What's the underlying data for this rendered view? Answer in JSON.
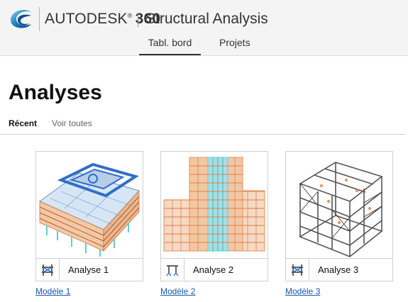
{
  "header": {
    "brand": "AUTODESK",
    "brand_number": "360",
    "brand_mark": "®",
    "product": "Structural Analysis",
    "logo_icon": "autodesk-logo-icon"
  },
  "nav": {
    "tabs": [
      {
        "label": "Tabl. bord",
        "active": true
      },
      {
        "label": "Projets",
        "active": false
      }
    ]
  },
  "main": {
    "title": "Analyses",
    "subtabs": [
      {
        "label": "Récent",
        "active": true
      },
      {
        "label": "Voir toutes",
        "active": false
      }
    ],
    "cards": [
      {
        "label": "Analyse 1",
        "link": "Modèle 1",
        "icon": "frame-structure-icon"
      },
      {
        "label": "Analyse 2",
        "link": "Modèle 2",
        "icon": "frame-supports-icon"
      },
      {
        "label": "Analyse 3",
        "link": "Modèle 3",
        "icon": "frame-structure-icon"
      }
    ]
  },
  "colors": {
    "accent_blue": "#2f6ec9",
    "beam_orange": "#e3905e",
    "column_cyan": "#5fcfd1",
    "frame_gray": "#555555",
    "link": "#1a56a8"
  }
}
